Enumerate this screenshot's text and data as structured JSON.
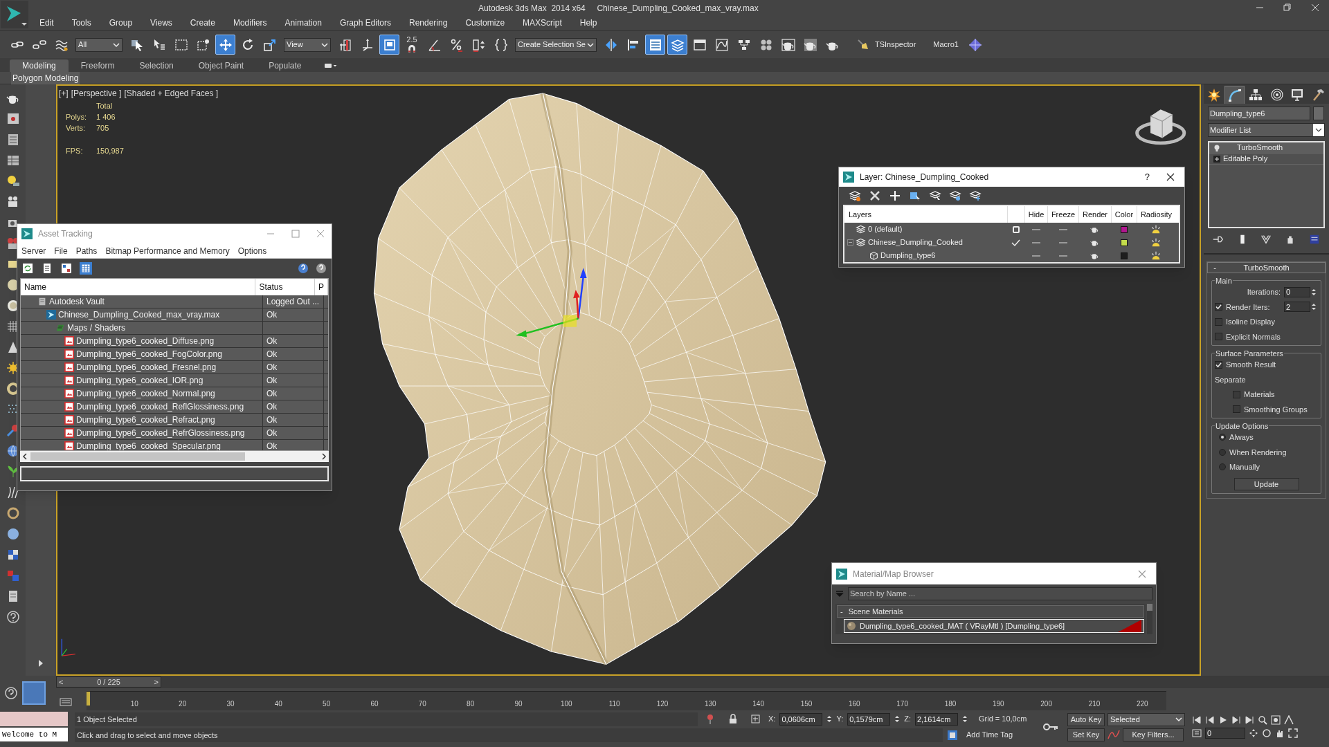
{
  "window": {
    "title": "Autodesk 3ds Max  2014 x64     Chinese_Dumpling_Cooked_max_vray.max"
  },
  "menu": [
    "Edit",
    "Tools",
    "Group",
    "Views",
    "Create",
    "Modifiers",
    "Animation",
    "Graph Editors",
    "Rendering",
    "Customize",
    "MAXScript",
    "Help"
  ],
  "toolbar": [
    {
      "kind": "icon",
      "selected": false
    },
    {
      "kind": "icon",
      "selected": false
    },
    {
      "kind": "icon",
      "selected": false
    },
    {
      "kind": "dropdown",
      "value": "All"
    },
    {
      "kind": "icon",
      "selected": false
    },
    {
      "kind": "icon",
      "selected": false
    },
    {
      "kind": "icon",
      "selected": false
    },
    {
      "kind": "icon",
      "selected": false
    },
    {
      "kind": "icon",
      "selected": true
    },
    {
      "kind": "icon",
      "selected": false
    },
    {
      "kind": "icon",
      "selected": false
    },
    {
      "kind": "dropdown",
      "value": "View"
    },
    {
      "kind": "icon",
      "selected": false
    },
    {
      "kind": "icon",
      "selected": false
    },
    {
      "kind": "icon",
      "selected": true
    },
    {
      "kind": "snap",
      "text": "2.5",
      "selected": false
    },
    {
      "kind": "icon",
      "selected": false
    },
    {
      "kind": "icon",
      "selected": false
    },
    {
      "kind": "icon",
      "selected": false
    },
    {
      "kind": "icon",
      "selected": false
    },
    {
      "kind": "dropdown",
      "value": "Create Selection Se"
    },
    {
      "kind": "icon",
      "selected": false
    },
    {
      "kind": "icon",
      "selected": false
    },
    {
      "kind": "icon",
      "selected": true
    },
    {
      "kind": "icon",
      "selected": true
    },
    {
      "kind": "icon",
      "selected": false
    },
    {
      "kind": "icon",
      "selected": false
    },
    {
      "kind": "icon",
      "selected": false
    },
    {
      "kind": "icon",
      "selected": false
    },
    {
      "kind": "icon",
      "selected": false
    },
    {
      "kind": "icon",
      "selected": false
    },
    {
      "kind": "icon",
      "selected": false
    },
    {
      "kind": "button",
      "text": "TSInspector"
    },
    {
      "kind": "button",
      "text": "Macro1"
    },
    {
      "kind": "icon",
      "selected": false
    }
  ],
  "ribbon": {
    "tabs": [
      {
        "label": "Modeling",
        "selected": true
      },
      {
        "label": "Freeform",
        "selected": false
      },
      {
        "label": "Selection",
        "selected": false
      },
      {
        "label": "Object Paint",
        "selected": false
      },
      {
        "label": "Populate",
        "selected": false
      }
    ],
    "panel": "Polygon Modeling"
  },
  "viewport": {
    "labels": [
      "[+]",
      "[Perspective ]",
      "[Shaded + Edged Faces ]"
    ],
    "stats": {
      "header": "Total",
      "counts": [
        {
          "label": "Polys:",
          "value": "1 406"
        },
        {
          "label": "Verts:",
          "value": "705"
        }
      ],
      "fps": {
        "label": "FPS:",
        "value": "150,987"
      }
    }
  },
  "asset_tracking": {
    "title": "Asset Tracking",
    "menu": [
      "Server",
      "File",
      "Paths",
      "Bitmap Performance and Memory",
      "Options"
    ],
    "columns": [
      "Name",
      "Status",
      "P"
    ],
    "tree": [
      {
        "kind": "vault",
        "name": "Autodesk Vault",
        "status": "Logged Out ...",
        "children": [
          {
            "kind": "scene",
            "name": "Chinese_Dumpling_Cooked_max_vray.max",
            "status": "Ok",
            "children": [
              {
                "kind": "folder",
                "name": "Maps / Shaders",
                "children": [
                  {
                    "kind": "bitmap",
                    "name": "Dumpling_type6_cooked_Diffuse.png",
                    "status": "Ok"
                  },
                  {
                    "kind": "bitmap",
                    "name": "Dumpling_type6_cooked_FogColor.png",
                    "status": "Ok"
                  },
                  {
                    "kind": "bitmap",
                    "name": "Dumpling_type6_cooked_Fresnel.png",
                    "status": "Ok"
                  },
                  {
                    "kind": "bitmap",
                    "name": "Dumpling_type6_cooked_IOR.png",
                    "status": "Ok"
                  },
                  {
                    "kind": "bitmap",
                    "name": "Dumpling_type6_cooked_Normal.png",
                    "status": "Ok"
                  },
                  {
                    "kind": "bitmap",
                    "name": "Dumpling_type6_cooked_ReflGlossiness.png",
                    "status": "Ok"
                  },
                  {
                    "kind": "bitmap",
                    "name": "Dumpling_type6_cooked_Refract.png",
                    "status": "Ok"
                  },
                  {
                    "kind": "bitmap",
                    "name": "Dumpling_type6_cooked_RefrGlossiness.png",
                    "status": "Ok"
                  },
                  {
                    "kind": "bitmap",
                    "name": "Dumpling_type6_cooked_Specular.png",
                    "status": "Ok"
                  }
                ]
              }
            ]
          }
        ]
      }
    ]
  },
  "layer_dialog": {
    "title": "Layer: Chinese_Dumpling_Cooked",
    "help": "?",
    "columns": [
      "Layers",
      "Hide",
      "Freeze",
      "Render",
      "Color",
      "Radiosity"
    ],
    "layers": [
      {
        "kind": "layer",
        "name": "0 (default)",
        "current": false,
        "hidden": false,
        "frozen": false,
        "renderable": true,
        "color": "#b0178f"
      },
      {
        "kind": "layer",
        "name": "Chinese_Dumpling_Cooked",
        "current": true,
        "expanded": true,
        "hidden": false,
        "frozen": false,
        "renderable": true,
        "color": "#c4dc4c",
        "children": [
          {
            "kind": "object",
            "name": "Dumpling_type6",
            "hidden": false,
            "frozen": false,
            "renderable": true,
            "color": "#1e1e1e"
          }
        ]
      }
    ]
  },
  "command_panel": {
    "tabs": [
      {
        "selected": false
      },
      {
        "selected": true
      },
      {
        "selected": false
      },
      {
        "selected": false
      },
      {
        "selected": false
      },
      {
        "selected": false
      }
    ],
    "object_name": "Dumpling_type6",
    "modifier_list": "Modifier List",
    "stack": [
      {
        "kind": "modifier",
        "label": "TurboSmooth"
      },
      {
        "kind": "base",
        "label": "Editable Poly"
      }
    ],
    "rollout": {
      "toggle": "-",
      "title": "TurboSmooth",
      "groups": [
        {
          "title": "Main",
          "controls": [
            {
              "kind": "spinner",
              "label": "Iterations:",
              "value": "0"
            },
            {
              "kind": "check_spinner",
              "label": "Render Iters:",
              "checked": true,
              "value": "2"
            },
            {
              "kind": "checkbox",
              "label": "Isoline Display",
              "checked": false
            },
            {
              "kind": "checkbox",
              "label": "Explicit Normals",
              "checked": false
            }
          ]
        },
        {
          "title": "Surface Parameters",
          "controls": [
            {
              "kind": "checkbox",
              "label": "Smooth Result",
              "checked": true
            },
            {
              "kind": "label",
              "text": "Separate"
            },
            {
              "kind": "sub_checkbox",
              "label": "Materials",
              "checked": false
            },
            {
              "kind": "sub_checkbox",
              "label": "Smoothing Groups",
              "checked": false
            }
          ]
        },
        {
          "title": "Update Options",
          "controls": [
            {
              "kind": "radio",
              "label": "Always",
              "selected": true
            },
            {
              "kind": "radio",
              "label": "When Rendering",
              "selected": false
            },
            {
              "kind": "radio",
              "label": "Manually",
              "selected": false
            },
            {
              "kind": "button",
              "label": "Update"
            }
          ]
        }
      ]
    }
  },
  "material_browser": {
    "title": "Material/Map Browser",
    "search_placeholder": "Search by Name ...",
    "group": {
      "toggle": "-",
      "label": "Scene Materials"
    },
    "items": [
      "Dumpling_type6_cooked_MAT ( VRayMtl ) [Dumpling_type6]"
    ]
  },
  "timeline": {
    "frame": "0 / 225",
    "prev": "<",
    "next": ">",
    "level": 0,
    "ticks": [
      "10",
      "20",
      "30",
      "40",
      "50",
      "60",
      "70",
      "80",
      "90",
      "100",
      "110",
      "120",
      "130",
      "140",
      "150",
      "160",
      "170",
      "180",
      "190",
      "200",
      "210",
      "220"
    ]
  },
  "status_bar": {
    "listener": "Welcome to M",
    "selection": "1 Object Selected",
    "prompt": "Click and drag to select and move objects",
    "coords": [
      {
        "label": "X:",
        "value": "0,0606cm"
      },
      {
        "label": "Y:",
        "value": "0,1579cm"
      },
      {
        "label": "Z:",
        "value": "2,1614cm"
      }
    ],
    "grid": "Grid = 10,0cm",
    "auto_key": "Auto Key",
    "set_key": "Set Key",
    "key_mode": "Selected",
    "key_filters": "Key Filters...",
    "add_time_tag": "Add Time Tag",
    "current_frame": "0"
  }
}
